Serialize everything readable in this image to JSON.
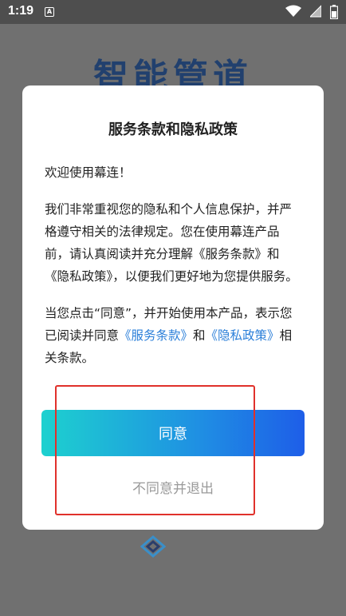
{
  "status_bar": {
    "time": "1:19",
    "notification_icon_letter": "A",
    "icons": [
      "wifi-icon",
      "signal-icon",
      "battery-icon"
    ]
  },
  "background": {
    "title": "智能管道"
  },
  "dialog": {
    "title": "服务条款和隐私政策",
    "welcome": "欢迎使用幕连！",
    "paragraph1": "我们非常重视您的隐私和个人信息保护，并严格遵守相关的法律规定。您在使用幕连产品前，请认真阅读并充分理解《服务条款》和《隐私政策》，以便我们更好地为您提供服务。",
    "p2_prefix": "当您点击“同意”，并开始使用本产品，表示您已阅读并同意",
    "p2_link_terms": "《服务条款》",
    "p2_and": "和",
    "p2_link_privacy": "《隐私政策》",
    "p2_suffix": "相关条款。",
    "agree_label": "同意",
    "disagree_label": "不同意并退出"
  },
  "colors": {
    "accent_gradient_start": "#1dd1cf",
    "accent_gradient_end": "#1e5ee8",
    "link": "#2b7fd9",
    "highlight": "#e0312b"
  }
}
